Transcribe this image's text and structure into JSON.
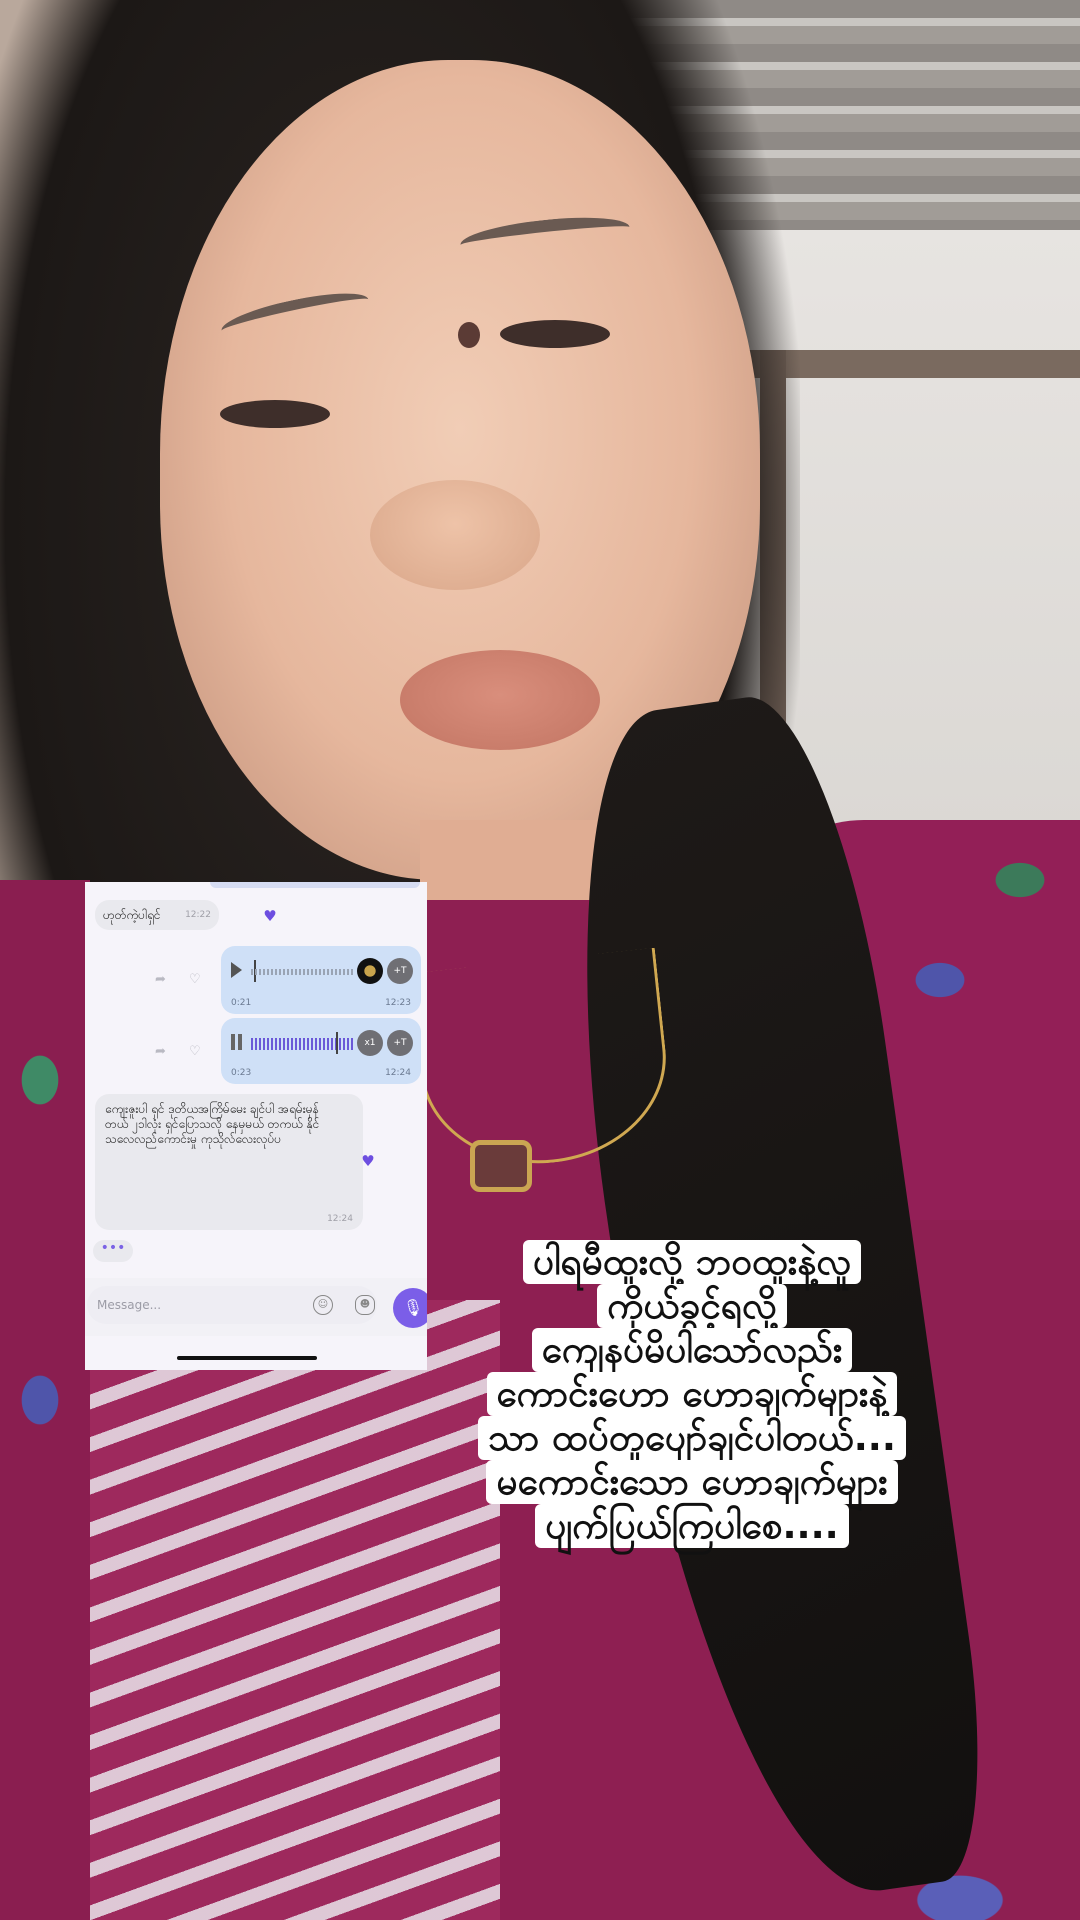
{
  "chat": {
    "message1": {
      "text": "ဟုတ်ကဲ့ပါရှင်",
      "time": "12:22",
      "reaction": "heart-icon"
    },
    "voice1": {
      "duration": "0:21",
      "time": "12:23",
      "transcribe": "+T"
    },
    "voice2": {
      "duration": "0:23",
      "time": "12:24",
      "speed": "x1",
      "transcribe": "+T"
    },
    "message2": {
      "text": "ကျေးဇူးပါ ရှင် ဒုတိယအကြိမ်မေး ချင်ပါ အရမ်းမှန်တယ် ၂၁ါလုံး ရှင်ပြောသလို နေမှမယ် တကယ် နိုင်သလေလည်ကောင်းမှု ကုသိုလ်လေးလုပ်ပ",
      "time": "12:24",
      "reaction": "heart-icon"
    },
    "typing": "•••",
    "composer": {
      "placeholder": "Message..."
    }
  },
  "caption": {
    "lines": [
      "ပါရမီထူးလို့ ဘ၀ထူးနဲ့လူ",
      "ကိုယ်ခွင့်ရလို့",
      "ကျေနပ်မိပါသော်လည်း",
      "ကောင်းဟော ဟောချက်များနဲ့",
      "သာ ထပ်တူပျော်ချင်ပါတယ်...",
      "မကောင်းသော ဟောချက်များ",
      "ပျက်ပြယ်ကြပါစေ...."
    ]
  },
  "colors": {
    "accent": "#7b5ee8",
    "outgoing_bubble": "#cfe0f7",
    "incoming_bubble": "#e9e9ee",
    "dress": "#8e1f52"
  }
}
